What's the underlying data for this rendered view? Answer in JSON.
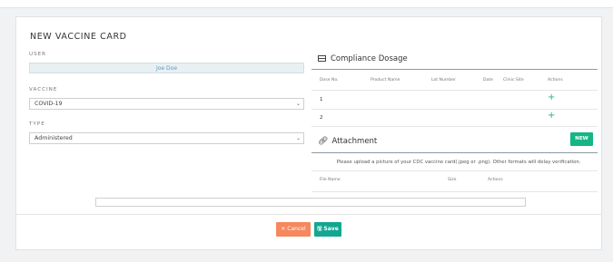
{
  "card": {
    "title": "NEW VACCINE CARD"
  },
  "form": {
    "user_label": "USER",
    "user_value": "Joe Doe",
    "vaccine_label": "VACCINE",
    "vaccine_value": "COVID-19",
    "type_label": "TYPE",
    "type_value": "Administered"
  },
  "compliance": {
    "title": "Compliance Dosage",
    "columns": [
      "Dose No.",
      "Product Name",
      "Lot Number",
      "Date",
      "Clinic Site",
      "Actions"
    ],
    "rows": [
      {
        "dose": "1",
        "action_icon": "+"
      },
      {
        "dose": "2",
        "action_icon": "+"
      }
    ]
  },
  "attachment": {
    "title": "Attachment",
    "new_label": "NEW",
    "note": "Please upload a picture of your CDC vaccine card(.jpeg or .png). Other formats will delay verification.",
    "columns": [
      "File Name",
      "Size",
      "Actions"
    ]
  },
  "footer": {
    "cancel_label": "✕ Cancel",
    "save_label": "🖫 Save"
  },
  "colors": {
    "accent": "#15b585",
    "cancel": "#f6875e",
    "save": "#12a791"
  }
}
